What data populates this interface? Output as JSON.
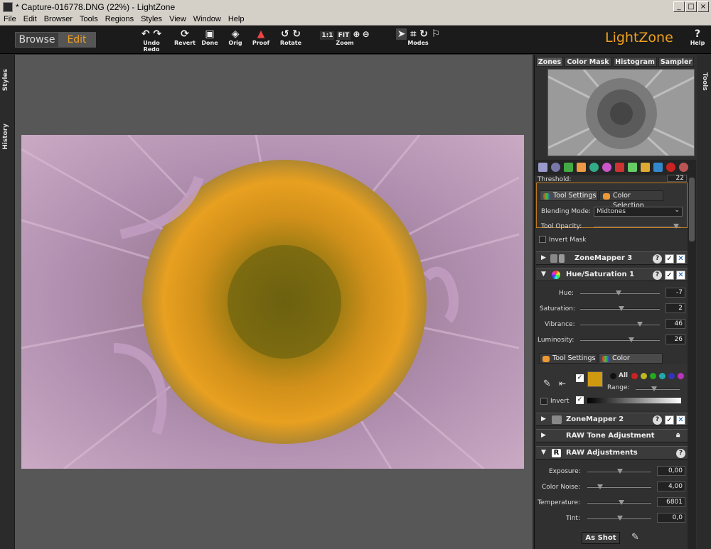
{
  "window": {
    "title": "* Capture-016778.DNG (22%) - LightZone",
    "min": "_",
    "max": "□",
    "close": "×"
  },
  "menu": [
    "File",
    "Edit",
    "Browser",
    "Tools",
    "Regions",
    "Styles",
    "View",
    "Window",
    "Help"
  ],
  "mode": {
    "browse": "Browse",
    "edit": "Edit"
  },
  "toolbar": {
    "undo_redo": "Undo Redo",
    "revert": "Revert",
    "done": "Done",
    "orig": "Orig",
    "proof": "Proof",
    "rotate": "Rotate",
    "zoom": "Zoom",
    "zoom_1to1": "1:1",
    "zoom_fit": "FIT",
    "modes": "Modes",
    "help": "Help"
  },
  "logo": "LightZone",
  "left_tabs": {
    "styles": "Styles",
    "history": "History"
  },
  "right_tab": "Tools",
  "zone_tabs": [
    "Zones",
    "Color Mask",
    "Histogram",
    "Sampler"
  ],
  "top_tool": {
    "threshold_label": "Threshold:",
    "threshold_value": "22",
    "tab_settings": "Tool Settings",
    "tab_color": "Color Selection",
    "blending_label": "Blending Mode:",
    "blending_value": "Midtones",
    "opacity_label": "Tool Opacity:",
    "invert_label": "Invert Mask"
  },
  "zonemapper3": {
    "name": "ZoneMapper 3",
    "help": "?"
  },
  "huesat": {
    "name": "Hue/Saturation 1",
    "help": "?",
    "hue_label": "Hue:",
    "hue": "-7",
    "sat_label": "Saturation:",
    "sat": "2",
    "vib_label": "Vibrance:",
    "vib": "46",
    "lum_label": "Luminosity:",
    "lum": "26",
    "tab_settings": "Tool Settings",
    "tab_color": "Color Selection",
    "all": "All",
    "range": "Range:",
    "invert": "Invert"
  },
  "zonemapper2": {
    "name": "ZoneMapper 2",
    "help": "?"
  },
  "rawtone": {
    "name": "RAW Tone Adjustment"
  },
  "rawadj": {
    "name": "RAW Adjustments",
    "help": "?",
    "exp_label": "Exposure:",
    "exp": "0,00",
    "noise_label": "Color Noise:",
    "noise": "4,00",
    "temp_label": "Temperature:",
    "temp": "6801",
    "tint_label": "Tint:",
    "tint": "0,0",
    "as_shot": "As Shot"
  }
}
